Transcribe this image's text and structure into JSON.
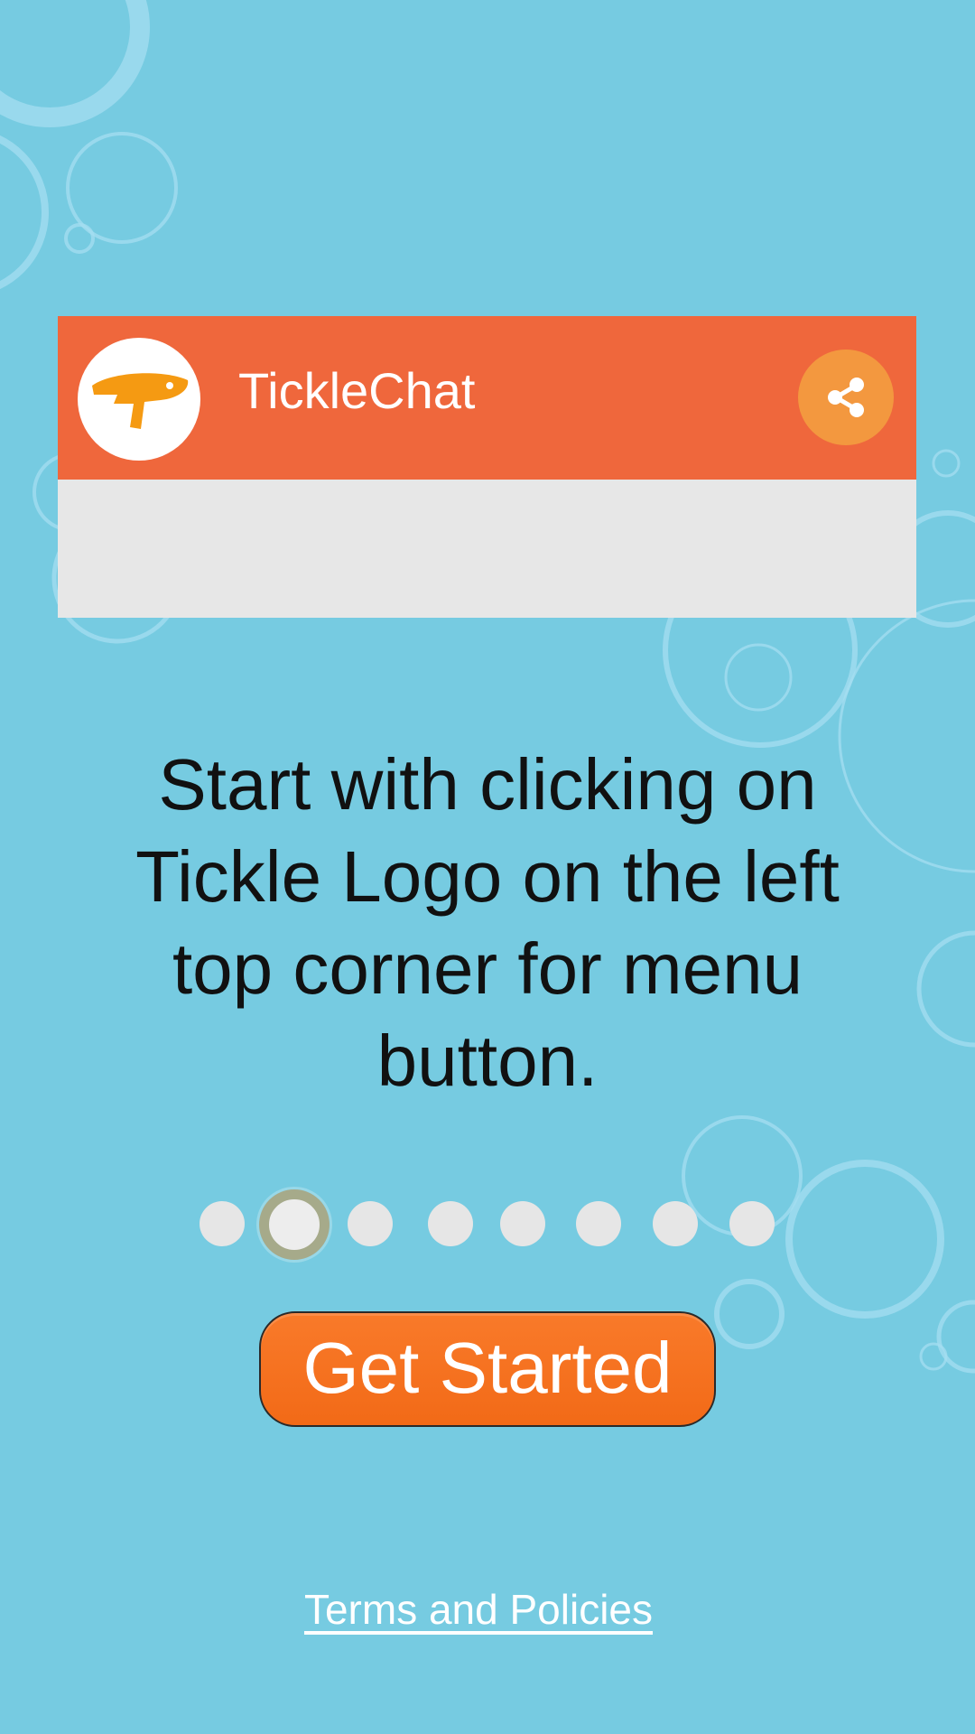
{
  "preview": {
    "app_title": "TickleChat",
    "logo_icon": "tickle-logo-icon",
    "share_icon": "share-icon"
  },
  "instruction": {
    "text": "Start with clicking on Tickle Logo on the left top corner for menu button."
  },
  "pager": {
    "total": 8,
    "current": 2
  },
  "actions": {
    "get_started_label": "Get Started",
    "terms_label": "Terms and Policies"
  },
  "colors": {
    "background": "#76cbe1",
    "appbar": "#ef673c",
    "share_button": "#f3983f",
    "get_started": "#f26a17",
    "dot_active_ring": "#a6aa8a"
  }
}
